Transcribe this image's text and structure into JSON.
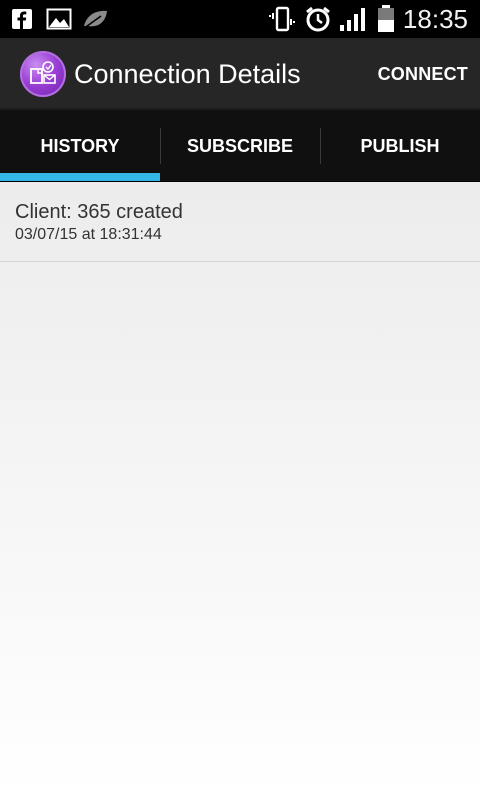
{
  "status_bar": {
    "time": "18:35",
    "icons": [
      "facebook-icon",
      "gallery-icon",
      "leaf-icon",
      "vibrate-icon",
      "alarm-icon",
      "signal-icon",
      "battery-icon"
    ]
  },
  "action_bar": {
    "title": "Connection Details",
    "connect_label": "CONNECT"
  },
  "tabs": [
    {
      "label": "HISTORY",
      "selected": true
    },
    {
      "label": "SUBSCRIBE",
      "selected": false
    },
    {
      "label": "PUBLISH",
      "selected": false
    }
  ],
  "history": [
    {
      "title": "Client: 365 created",
      "subtitle": "03/07/15 at 18:31:44"
    }
  ],
  "colors": {
    "accent": "#33b5e5",
    "action_bar": "#262626",
    "tab_bar": "#101010"
  }
}
